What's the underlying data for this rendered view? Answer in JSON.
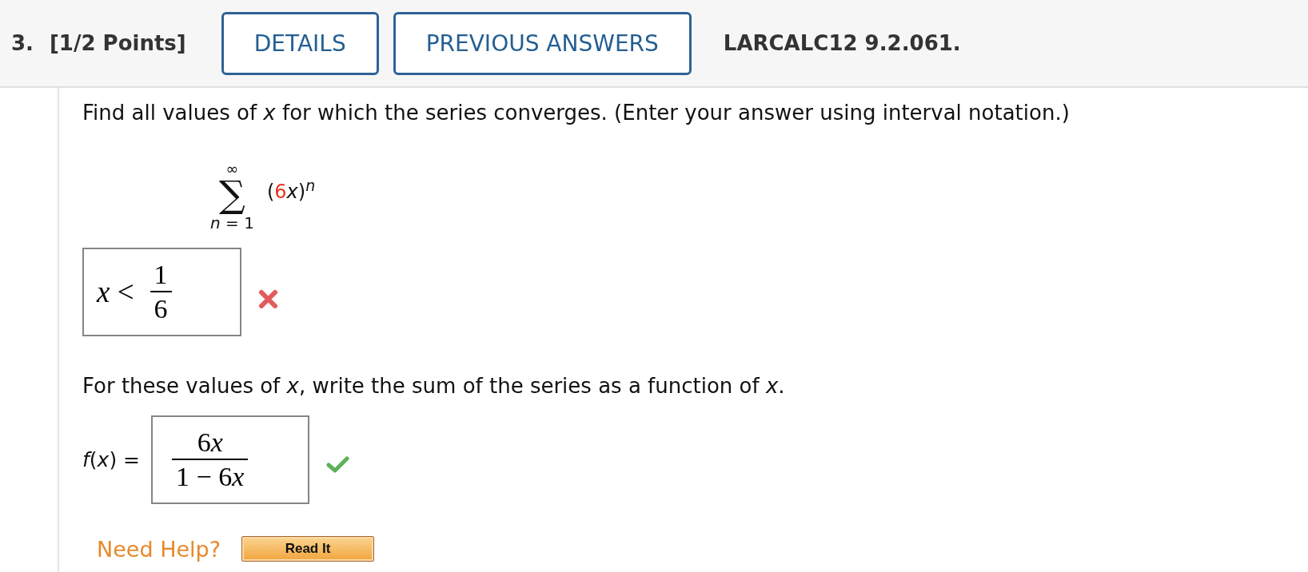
{
  "header": {
    "number": "3.",
    "points": "[1/2 Points]",
    "buttons": [
      "DETAILS",
      "PREVIOUS ANSWERS"
    ],
    "problem_id": "LARCALC12 9.2.061."
  },
  "question": "Find all values of *x* for which the series converges. (Enter your answer using interval notation.)",
  "series": {
    "sigma": "∑",
    "upper": "∞",
    "lower": "n = 1",
    "term": [
      {
        "text": "(",
        "highlighted": false
      },
      {
        "text": "6",
        "highlighted": true
      },
      {
        "text": "x)",
        "highlighted": false
      }
    ],
    "exponent": "n"
  },
  "answers": [
    {
      "value_lhs": "x <",
      "numerator": "1",
      "denominator": "6",
      "correct": false
    }
  ],
  "followup": "For these values of *x*, write the sum of the series as a function of *x*.",
  "function_answers": [
    {
      "label": "f(x) =",
      "numerator": "6x",
      "denominator": "1 − 6x",
      "correct": true
    }
  ],
  "help": {
    "label": "Need Help?",
    "buttons": [
      "Read It"
    ]
  }
}
